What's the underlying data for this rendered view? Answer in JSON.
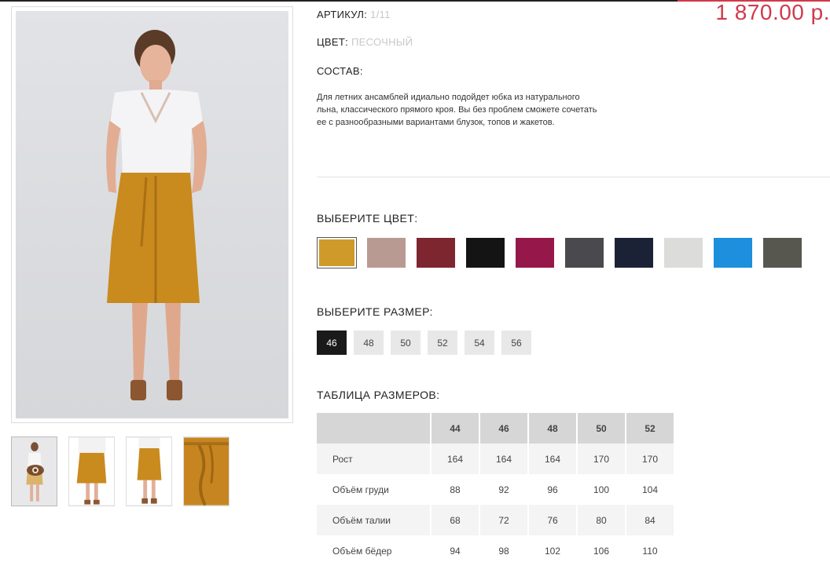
{
  "product": {
    "article_label": "АРТИКУЛ:",
    "article_value": "1/11",
    "color_label": "ЦВЕТ:",
    "color_value": "ПЕСОЧНЫЙ",
    "composition_label": "СОСТАВ:",
    "price": "1 870.00 р.",
    "description": "Для летних ансамблей идиально подойдет юбка из натурального льна, классического прямого кроя. Вы без проблем сможете сочетать ее с разнообразными вариантами блузок, топов и жакетов."
  },
  "colors": {
    "title": "ВЫБЕРИТЕ ЦВЕТ:",
    "swatches": [
      {
        "name": "ochre",
        "hex": "#cf9a2a",
        "selected": true
      },
      {
        "name": "dusty-pink",
        "hex": "#b99a92"
      },
      {
        "name": "wine",
        "hex": "#7e2630"
      },
      {
        "name": "black",
        "hex": "#141414"
      },
      {
        "name": "magenta",
        "hex": "#96184a"
      },
      {
        "name": "graphite",
        "hex": "#4a4a4e"
      },
      {
        "name": "navy",
        "hex": "#1c2236"
      },
      {
        "name": "light-grey",
        "hex": "#dcdcda"
      },
      {
        "name": "sky-blue",
        "hex": "#1d8fdc"
      },
      {
        "name": "dark-grey",
        "hex": "#58574f"
      }
    ]
  },
  "sizes": {
    "title": "ВЫБЕРИТЕ РАЗМЕР:",
    "options": [
      "46",
      "48",
      "50",
      "52",
      "54",
      "56"
    ],
    "selected": "46"
  },
  "size_table": {
    "title": "ТАБЛИЦА РАЗМЕРОВ:",
    "columns": [
      "44",
      "46",
      "48",
      "50",
      "52"
    ],
    "rows": [
      {
        "label": "Рост",
        "values": [
          "164",
          "164",
          "164",
          "170",
          "170"
        ]
      },
      {
        "label": "Объём груди",
        "values": [
          "88",
          "92",
          "96",
          "100",
          "104"
        ]
      },
      {
        "label": "Объём талии",
        "values": [
          "68",
          "72",
          "76",
          "80",
          "84"
        ]
      },
      {
        "label": "Объём бёдер",
        "values": [
          "94",
          "98",
          "102",
          "106",
          "110"
        ]
      }
    ]
  },
  "gallery": {
    "thumbnails": [
      "full-figure",
      "skirt-front",
      "skirt-back",
      "fabric-closeup"
    ],
    "active_icon": "eye-icon"
  }
}
